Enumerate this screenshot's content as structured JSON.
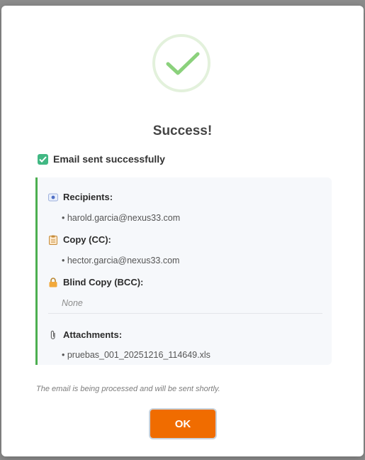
{
  "dialog": {
    "title": "Success!",
    "status": "Email sent successfully",
    "note": "The email is being processed and will be sent shortly.",
    "ok_label": "OK",
    "icons": [
      "success-check-icon",
      "check-box-icon",
      "recipients-icon",
      "clipboard-icon",
      "lock-icon",
      "paperclip-icon"
    ],
    "colors": {
      "accent": "#f06c00",
      "success": "#4caf50",
      "check_ring": "#e3f1dc",
      "check_mark": "#8bd17c"
    }
  },
  "details": {
    "recipients": {
      "label": "Recipients:",
      "items": [
        "• harold.garcia@nexus33.com"
      ]
    },
    "cc": {
      "label": "Copy (CC):",
      "items": [
        "• hector.garcia@nexus33.com"
      ]
    },
    "bcc": {
      "label": "Blind Copy (BCC):",
      "empty": "None"
    },
    "attachments": {
      "label": "Attachments:",
      "items": [
        "• pruebas_001_20251216_114649.xls"
      ]
    }
  }
}
